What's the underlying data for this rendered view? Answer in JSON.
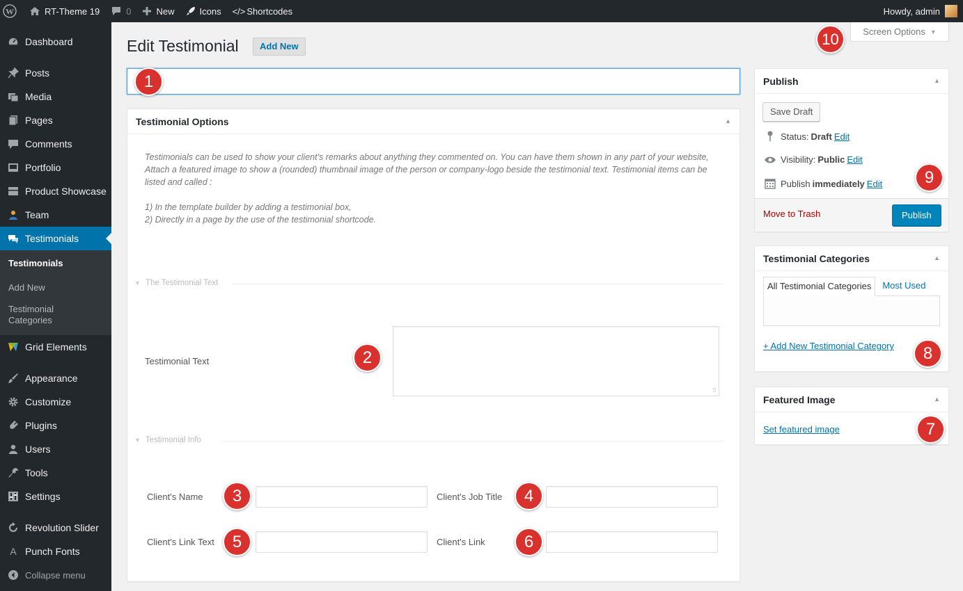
{
  "adminbar": {
    "site_name": "RT-Theme 19",
    "comments_count": "0",
    "new_label": "New",
    "icons_label": "Icons",
    "shortcodes_label": "Shortcodes",
    "howdy": "Howdy, admin"
  },
  "sidebar": {
    "items": [
      {
        "label": "Dashboard",
        "icon": "dashboard-icon"
      },
      {
        "label": "Posts",
        "icon": "pin-icon"
      },
      {
        "label": "Media",
        "icon": "media-icon"
      },
      {
        "label": "Pages",
        "icon": "pages-icon"
      },
      {
        "label": "Comments",
        "icon": "comment-icon"
      },
      {
        "label": "Portfolio",
        "icon": "portfolio-icon"
      },
      {
        "label": "Product Showcase",
        "icon": "product-icon"
      },
      {
        "label": "Team",
        "icon": "team-icon"
      },
      {
        "label": "Testimonials",
        "icon": "testimonial-icon"
      }
    ],
    "submenu": [
      "Testimonials",
      "Add New",
      "Testimonial Categories"
    ],
    "items2": [
      {
        "label": "Grid Elements",
        "icon": "grid-icon"
      },
      {
        "label": "Appearance",
        "icon": "brush-icon"
      },
      {
        "label": "Customize",
        "icon": "gear-icon"
      },
      {
        "label": "Plugins",
        "icon": "plugin-icon"
      },
      {
        "label": "Users",
        "icon": "user-icon"
      },
      {
        "label": "Tools",
        "icon": "wrench-icon"
      },
      {
        "label": "Settings",
        "icon": "settings-icon"
      },
      {
        "label": "Revolution Slider",
        "icon": "refresh-icon"
      },
      {
        "label": "Punch Fonts",
        "icon": "font-icon"
      }
    ],
    "collapse": "Collapse menu"
  },
  "page": {
    "title": "Edit Testimonial",
    "add_new": "Add New",
    "screen_options": "Screen Options",
    "title_value": ""
  },
  "options_box": {
    "title": "Testimonial Options",
    "desc_line1": "Testimonials can be used to show your client's remarks about anything they commented on. You can have them shown in any part of your website, Attach a featured image to show a (rounded) thumbnail image of the person or company-logo beside the testimonial text. Testimonial items can be listed and called :",
    "desc_line2": "1) In the template builder by adding a testimonial box,",
    "desc_line3": "2) Directly in a page by the use of the testimonial shortcode.",
    "section_text": "The Testimonial Text",
    "testimonial_text_label": "Testimonial Text",
    "section_info": "Testimonial Info",
    "client_name": "Client's Name",
    "client_job": "Client's Job Title",
    "client_link_text": "Client's Link Text",
    "client_link": "Client's Link"
  },
  "publish": {
    "title": "Publish",
    "save_draft": "Save Draft",
    "status_label": "Status:",
    "status_value": "Draft",
    "visibility_label": "Visibility:",
    "visibility_value": "Public",
    "publish_label": "Publish",
    "publish_value": "immediately",
    "edit": "Edit",
    "trash": "Move to Trash",
    "publish_button": "Publish"
  },
  "categories": {
    "title": "Testimonial Categories",
    "tab_all": "All Testimonial Categories",
    "tab_most": "Most Used",
    "add_new": "+ Add New Testimonial Category"
  },
  "featured": {
    "title": "Featured Image",
    "set": "Set featured image"
  },
  "badges": [
    "1",
    "2",
    "3",
    "4",
    "5",
    "6",
    "7",
    "8",
    "9",
    "10"
  ],
  "colors": {
    "accent": "#0073aa",
    "badge": "#d9312d",
    "adminbar": "#23282d"
  }
}
